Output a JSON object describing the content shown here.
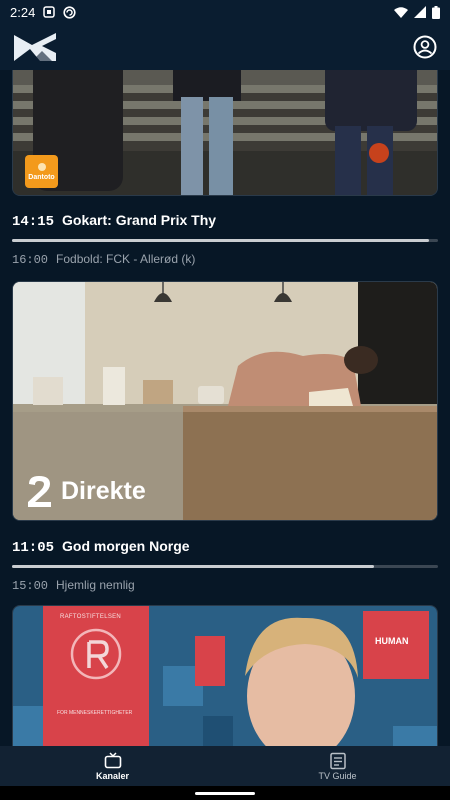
{
  "status_bar": {
    "time": "2:24"
  },
  "header": {
    "logo_icon": "app-logo-icon",
    "account_icon": "account-circle-icon"
  },
  "channels": [
    {
      "badge_label": "Dantoto",
      "now": {
        "time": "14:15",
        "title": "Gokart: Grand Prix Thy",
        "progress": 0.98
      },
      "next": {
        "time": "16:00",
        "title": "Fodbold: FCK - Allerød (k)"
      }
    },
    {
      "overlay_label": "Direkte",
      "now": {
        "time": "11:05",
        "title": "God morgen Norge",
        "progress": 0.85
      },
      "next": {
        "time": "15:00",
        "title": "Hjemlig nemlig"
      }
    },
    {
      "sign_left_top": "RAFTOSTIFTELSEN",
      "sign_left_bottom": "FOR MENNESKERETTIGHETER",
      "sign_right_top": "HUMAN"
    }
  ],
  "bottom_nav": {
    "items": [
      {
        "label": "Kanaler",
        "icon": "tv-icon",
        "active": true
      },
      {
        "label": "TV Guide",
        "icon": "guide-icon",
        "active": false
      }
    ]
  },
  "colors": {
    "background": "#071726",
    "header": "#0a1d30",
    "nav": "#122233",
    "badge": "#f39a1c"
  }
}
